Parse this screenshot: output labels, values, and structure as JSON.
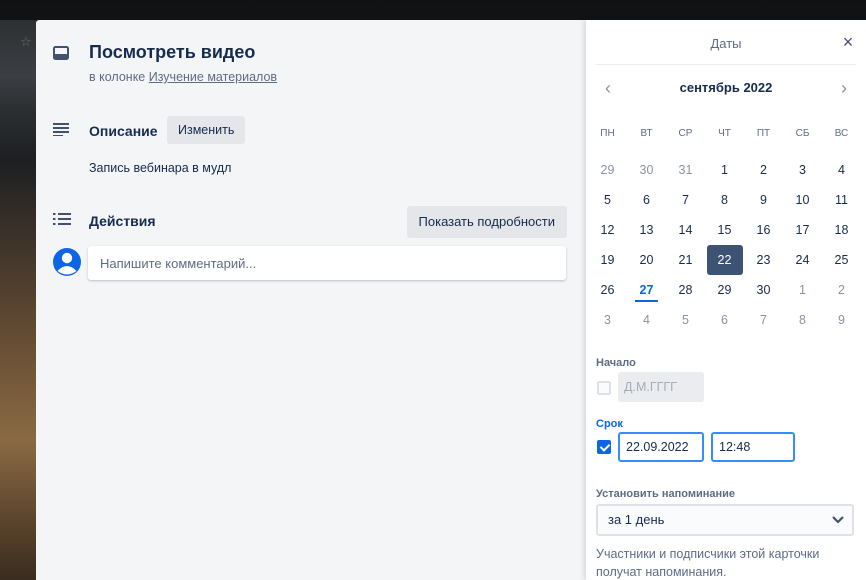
{
  "card": {
    "title": "Посмотреть видео",
    "in_list_prefix": "в колонке",
    "list_name": "Изучение материалов",
    "description": {
      "title": "Описание",
      "edit_label": "Изменить",
      "text": "Запись вебинара в мудл"
    },
    "activity": {
      "title": "Действия",
      "details_label": "Показать подробности",
      "comment_placeholder": "Напишите комментарий..."
    }
  },
  "dates": {
    "title": "Даты",
    "close_glyph": "×",
    "prev_glyph": "‹",
    "next_glyph": "›",
    "month_label": "сентябрь 2022",
    "weekdays": [
      "ПН",
      "ВТ",
      "СР",
      "ЧТ",
      "ПТ",
      "СБ",
      "ВС"
    ],
    "weeks": [
      [
        "29",
        "30",
        "31",
        "1",
        "2",
        "3",
        "4"
      ],
      [
        "5",
        "6",
        "7",
        "8",
        "9",
        "10",
        "11"
      ],
      [
        "12",
        "13",
        "14",
        "15",
        "16",
        "17",
        "18"
      ],
      [
        "19",
        "20",
        "21",
        "22",
        "23",
        "24",
        "25"
      ],
      [
        "26",
        "27",
        "28",
        "29",
        "30",
        "1",
        "2"
      ],
      [
        "3",
        "4",
        "5",
        "6",
        "7",
        "8",
        "9"
      ]
    ],
    "selected_day": "22",
    "today_day": "27",
    "start": {
      "label": "Начало",
      "placeholder": "Д.М.ГГГГ",
      "checked": false
    },
    "due": {
      "label": "Срок",
      "date": "22.09.2022",
      "time": "12:48",
      "checked": true
    },
    "reminder": {
      "label": "Установить напоминание",
      "value": "за 1 день",
      "note": "Участники и подписчики этой карточки получат напоминания."
    }
  },
  "colors": {
    "accent": "#0c66e4",
    "selected_day_bg": "#3c5373",
    "card_bg": "#f4f5f7"
  }
}
